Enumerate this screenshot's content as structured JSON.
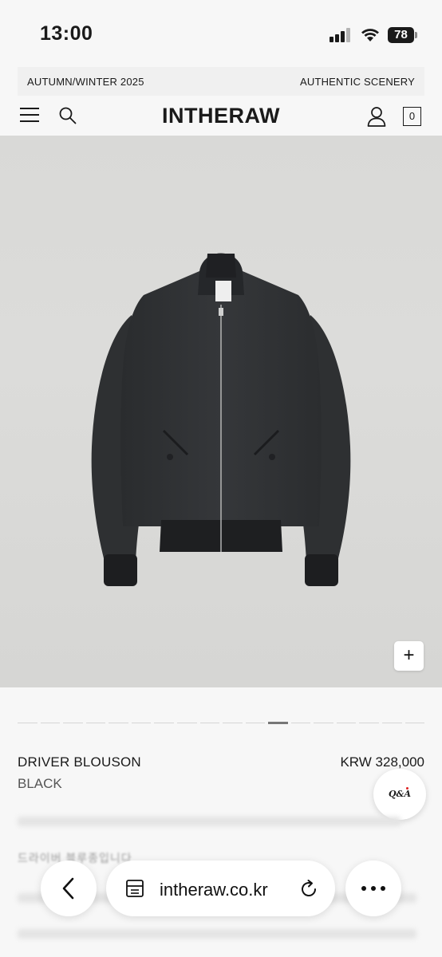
{
  "status_bar": {
    "time": "13:00",
    "battery": "78"
  },
  "announcement": {
    "left": "AUTUMN/WINTER 2025",
    "right": "AUTHENTIC SCENERY"
  },
  "header": {
    "logo": "INTHERAW",
    "cart_count": "0"
  },
  "hero": {
    "zoom_label": "+"
  },
  "gallery": {
    "slide_count": 18,
    "active_index": 11
  },
  "product": {
    "name": "DRIVER BLOUSON",
    "color": "BLACK",
    "price": "KRW 328,000"
  },
  "qa_button": {
    "label": "Q&A"
  },
  "description_preview": "드라이버 블루종입니다",
  "browser": {
    "url": "intheraw.co.kr"
  },
  "icons": [
    "menu-icon",
    "search-icon",
    "user-icon",
    "cart-icon",
    "plus-icon",
    "back-icon",
    "tabs-icon",
    "reload-icon",
    "more-icon"
  ]
}
